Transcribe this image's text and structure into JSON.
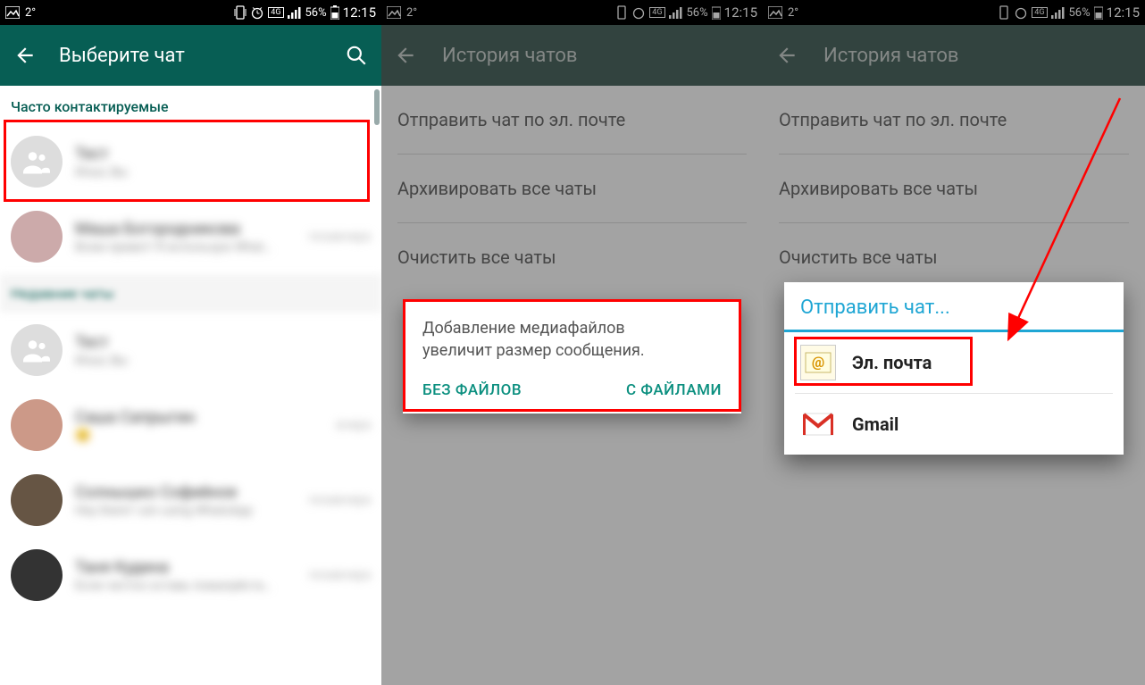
{
  "status": {
    "temp": "2°",
    "battery": "56%",
    "time": "12:15",
    "net": "4G"
  },
  "screen1": {
    "title": "Выберите чат",
    "section_freq": "Часто контактируемые",
    "section_recent": "Недавние чаты",
    "rows": [
      {
        "name": "Тест",
        "sub": "Илья, Вы"
      },
      {
        "name": "Маша Богородникова",
        "sub": "Всем привет! Я использую What…",
        "time": "позавчера"
      },
      {
        "name": "Тест",
        "sub": "Илья, Вы"
      },
      {
        "name": "Саша Сапрыгин",
        "sub": "😊",
        "time": "вчера"
      },
      {
        "name": "Солнышко Софийное",
        "sub": "Hey there! I am using WhatsApp",
        "time": "позавчера"
      },
      {
        "name": "Таня Кудина",
        "sub": "Если честно оставь пожалуйста…",
        "time": "позавчера"
      }
    ]
  },
  "screen2": {
    "title": "История чатов",
    "items": {
      "email": "Отправить чат по эл. почте",
      "archive": "Архивировать все чаты",
      "clear": "Очистить все чаты"
    },
    "dialog": {
      "text1": "Добавление медиафайлов",
      "text2": "увеличит размер сообщения.",
      "btn_no": "БЕЗ ФАЙЛОВ",
      "btn_yes": "С ФАЙЛАМИ"
    }
  },
  "screen3": {
    "title": "История чатов",
    "items": {
      "email": "Отправить чат по эл. почте",
      "archive": "Архивировать все чаты",
      "clear": "Очистить все чаты"
    },
    "share": {
      "title": "Отправить чат...",
      "opt_email": "Эл. почта",
      "opt_gmail": "Gmail"
    }
  }
}
